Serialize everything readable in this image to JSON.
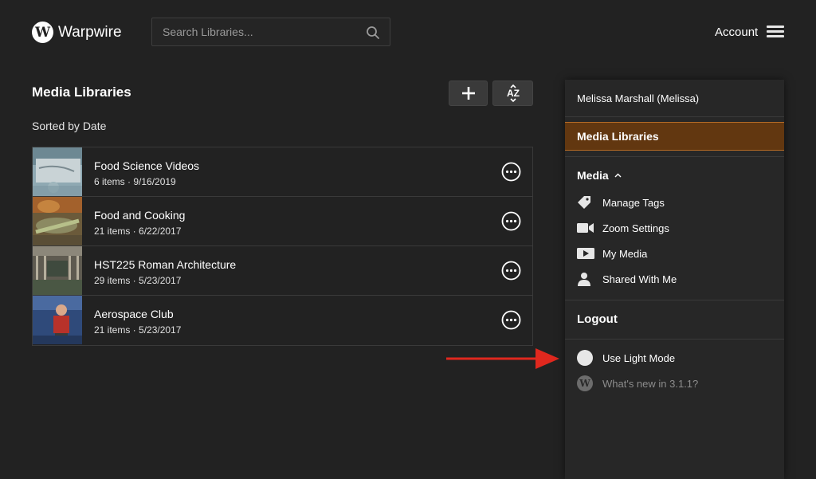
{
  "header": {
    "logo_letter": "W",
    "brand": "Warpwire",
    "search_placeholder": "Search Libraries...",
    "account_label": "Account"
  },
  "main": {
    "title": "Media Libraries",
    "sort_text": "Sorted by Date",
    "add_label": "+",
    "sort_icon_label": "AZ",
    "libraries": [
      {
        "title": "Food Science Videos",
        "meta": "6 items · 9/16/2019"
      },
      {
        "title": "Food and Cooking",
        "meta": "21 items · 6/22/2017"
      },
      {
        "title": "HST225 Roman Architecture",
        "meta": "29 items · 5/23/2017"
      },
      {
        "title": "Aerospace Club",
        "meta": "21 items · 5/23/2017"
      }
    ]
  },
  "panel": {
    "user": "Melissa Marshall (Melissa)",
    "active": "Media Libraries",
    "media_section": "Media",
    "items": [
      {
        "label": "Manage Tags",
        "icon": "tag-icon"
      },
      {
        "label": "Zoom Settings",
        "icon": "video-camera-icon"
      },
      {
        "label": "My Media",
        "icon": "play-icon"
      },
      {
        "label": "Shared With Me",
        "icon": "person-icon"
      }
    ],
    "logout": "Logout",
    "light_mode": "Use Light Mode",
    "whats_new": "What's new in 3.1.1?",
    "whats_new_badge": "W"
  },
  "colors": {
    "background": "#222222",
    "panel": "#272727",
    "active_bg": "#623710",
    "active_border": "#b46a25",
    "arrow": "#e0281e"
  }
}
